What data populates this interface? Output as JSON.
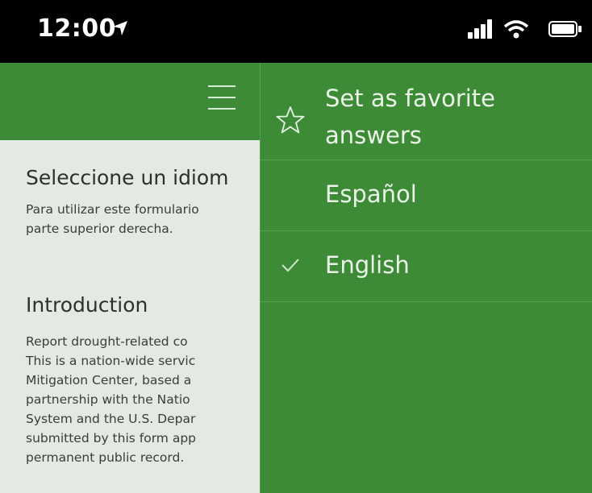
{
  "status_bar": {
    "time": "12:00"
  },
  "icons": {
    "location": "location-arrow-icon",
    "signal": "cellular-signal-icon",
    "wifi": "wifi-icon",
    "battery": "battery-icon",
    "menu": "hamburger-menu-icon",
    "favorite": "star-outline-icon",
    "selected": "checkmark-icon"
  },
  "colors": {
    "header_green": "#3d8b37",
    "content_background": "#e3e9e3",
    "status_bar": "#000000"
  },
  "content": {
    "language_title": "Seleccione un idiom",
    "language_text": [
      "Para utilizar este formulario",
      "parte superior derecha."
    ],
    "intro_title": "Introduction",
    "intro_text": [
      "Report drought-related co",
      "This is a nation-wide servic",
      "Mitigation Center, based a",
      "partnership with the Natio",
      "System and the U.S. Depar",
      "submitted by this form app",
      "permanent public record."
    ]
  },
  "menu": {
    "favorite_label_line1": "Set as favorite",
    "favorite_label_line2": "answers",
    "items": [
      {
        "label": "Español",
        "selected": false
      },
      {
        "label": "English",
        "selected": true
      }
    ]
  }
}
